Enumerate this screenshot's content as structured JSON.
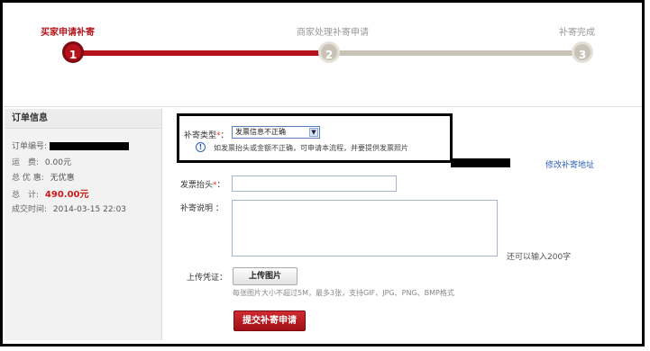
{
  "steps": [
    {
      "label": "买家申请补寄",
      "number": "1"
    },
    {
      "label": "商家处理补寄申请",
      "number": "2"
    },
    {
      "label": "补寄完成",
      "number": "3"
    }
  ],
  "order": {
    "title": "订单信息",
    "number_label": "订单编号:",
    "shipping_label": "运　费:",
    "shipping_value": "0.00元",
    "discount_label": "总 优 惠:",
    "discount_value": "无优惠",
    "total_label": "总　计:",
    "total_value": "490.00元",
    "time_label": "成交时间:",
    "time_value": "2014-03-15 22:03"
  },
  "form": {
    "type_label": "补寄类型",
    "type_selected": "发票信息不正确",
    "hint": "如发票抬头或金额不正确，可申请本流程，并要提供发票照片",
    "edit_address_link": "修改补寄地址",
    "invoice_title_label": "发票抬头",
    "description_label": "补寄说明 ：",
    "char_hint": "还可以输入200字",
    "upload_label": "上传凭证：",
    "upload_button": "上传图片",
    "upload_note": "每张图片大小不超过5M，最多3张，支持GIF、JPG、PNG、BMP格式",
    "submit_button": "提交补寄申请",
    "required_mark": "*",
    "colon": "："
  },
  "colors": {
    "accent": "#b5121b",
    "link": "#2b5fb4",
    "price": "#cc1b1b"
  }
}
